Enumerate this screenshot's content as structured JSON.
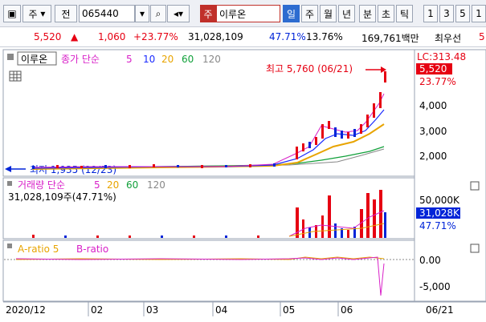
{
  "toolbar": {
    "market": "주",
    "code_prefix": "전",
    "code": "065440",
    "name_prefix": "주",
    "name": "이루온",
    "periods": [
      "일",
      "주",
      "월",
      "년",
      "분",
      "초",
      "틱"
    ],
    "active_period": "일",
    "counts": [
      "1",
      "3",
      "5",
      "1"
    ]
  },
  "info": {
    "price": "5,520",
    "change": "1,060",
    "change_pct": "+23.77%",
    "volume": "31,028,109",
    "vol_ratio": "47.71%",
    "turnover": "13.76%",
    "amount": "169,761백만",
    "trailing": "최우선",
    "trailing2": "5"
  },
  "price_panel": {
    "stock_label": "이루온",
    "ma_title": "종가 단순",
    "ma_periods": [
      "5",
      "10",
      "20",
      "60",
      "120"
    ],
    "high_label": "최고 5,760 (06/21)",
    "low_label": "최저 1,935 (12/23)",
    "axis_ticks": [
      "4,000",
      "3,000",
      "2,000"
    ],
    "lc_label": "LC:313.48",
    "price_tag": "5,520",
    "pct_tag": "23.77%"
  },
  "volume_panel": {
    "title": "거래량 단순",
    "ma_periods": [
      "5",
      "20",
      "60",
      "120"
    ],
    "subtitle": "31,028,109주(47.71%)",
    "axis_ticks": [
      "50,000K"
    ],
    "tag": "31,028K",
    "pct_tag": "47.71%"
  },
  "ratio_panel": {
    "title_a": "A-ratio 5",
    "title_b": "B-ratio",
    "axis_ticks": [
      "0.00",
      "-5,000"
    ]
  },
  "xaxis": {
    "labels": [
      "2020/12",
      "02",
      "03",
      "04",
      "05",
      "06"
    ],
    "date_label": "06/21"
  },
  "chart_data": [
    {
      "type": "candlestick",
      "title": "",
      "y_ticks": [
        "4,000",
        "3,000",
        "2,000"
      ],
      "high": 5760,
      "high_date": "06/21",
      "low": 1935,
      "low_date": "12/23",
      "close": 5520,
      "note": "price with moving averages 5,10,20,60,120"
    },
    {
      "type": "bar",
      "title": "거래량",
      "y_ticks": [
        "50,000K"
      ],
      "last_value": 31028109
    },
    {
      "type": "line",
      "title": "A-ratio / B-ratio",
      "y_ticks": [
        "0.00",
        "-5,000"
      ]
    }
  ],
  "colors": {
    "up": "#e60012",
    "down": "#0024d8",
    "ma5": "#d820c8",
    "ma10": "#1b2bff",
    "ma20": "#e8a400",
    "ma60": "#11a03a",
    "ma120": "#888888"
  }
}
